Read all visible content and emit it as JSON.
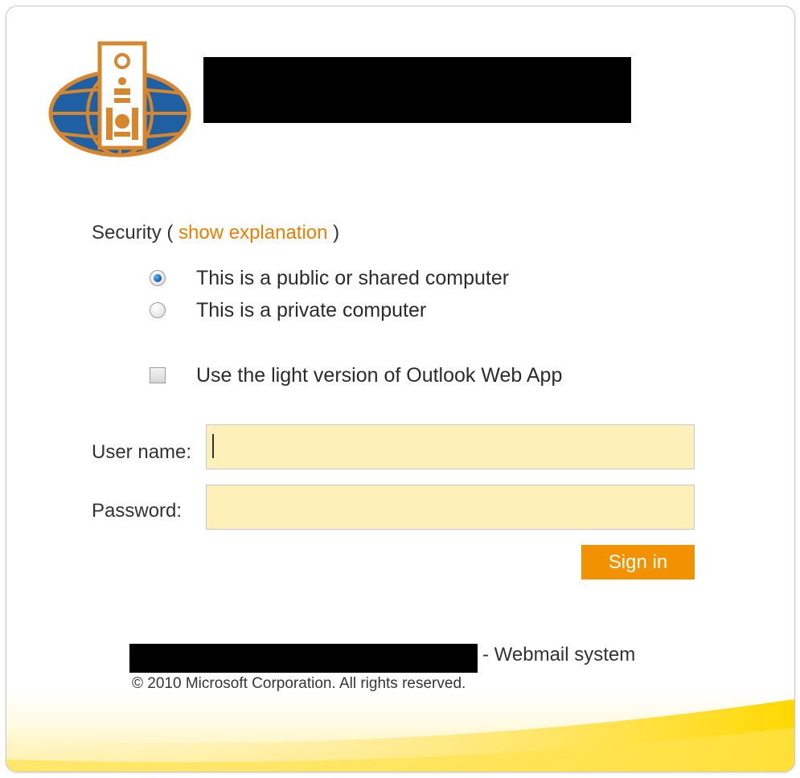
{
  "security": {
    "prefix": "Security (",
    "link": "show explanation",
    "suffix": ")"
  },
  "options": {
    "public_label": "This is a public or shared computer",
    "private_label": "This is a private computer",
    "selected": "public",
    "light_version_label": "Use the light version of Outlook Web App",
    "light_version_checked": false
  },
  "form": {
    "username_label": "User name:",
    "username_value": "",
    "password_label": "Password:",
    "password_value": "",
    "signin_label": "Sign in"
  },
  "footer": {
    "system_label": "- Webmail system",
    "copyright": "© 2010 Microsoft Corporation. All rights reserved."
  },
  "colors": {
    "accent": "#f39200",
    "link": "#ef7d00",
    "input_bg": "#fdf0b8"
  }
}
